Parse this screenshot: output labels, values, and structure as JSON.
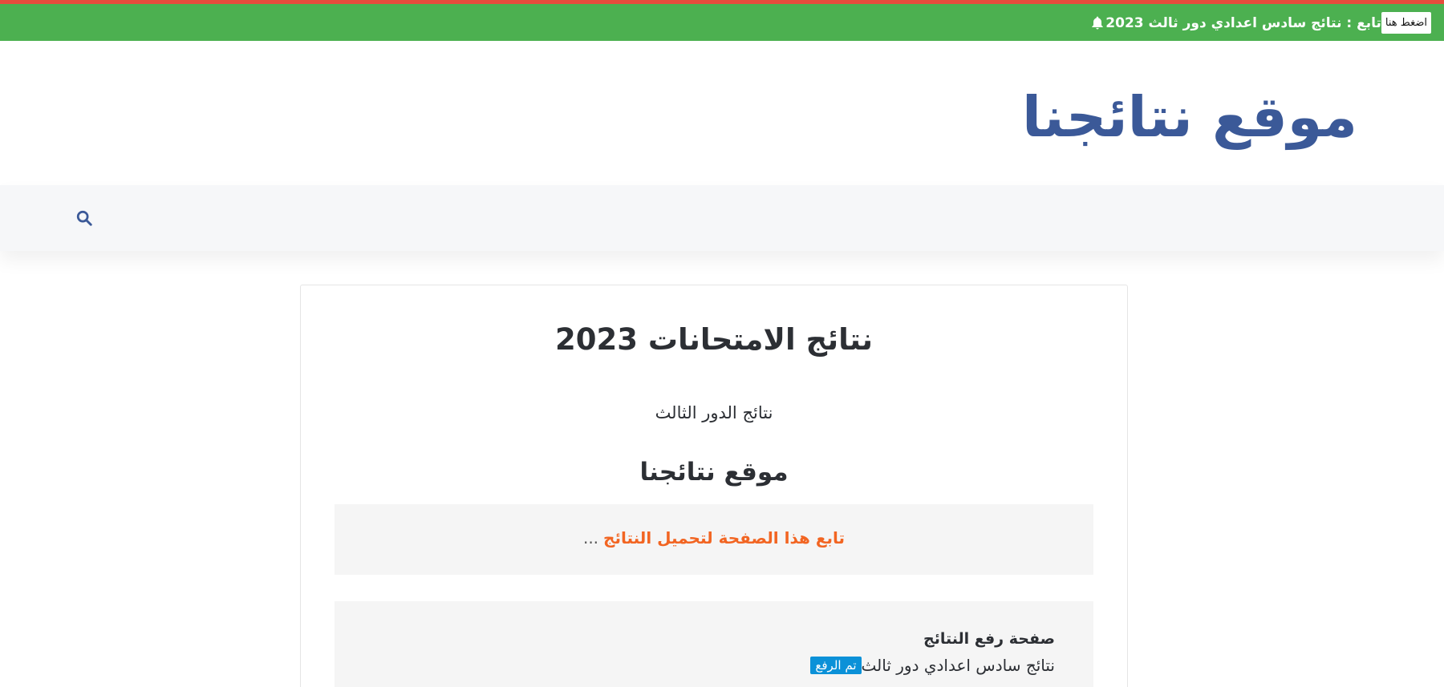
{
  "topbar": {
    "ticker_text": "تابع : نتائج سادس اعدادي دور ثالث 2023",
    "button_label": "اضغط هنا",
    "bar_color": "#4cb050",
    "accent_color": "#e74c3c",
    "icon": "bell-icon"
  },
  "header": {
    "site_title": "موقع نتائجنا",
    "title_color": "#3b5998"
  },
  "nav": {
    "icon": "search-icon"
  },
  "post": {
    "title": "نتائج الامتحانات 2023",
    "subtitle": "نتائج الدور الثالث",
    "site_name": "موقع نتائجنا",
    "notice_link": "تابع هذا الصفحة لتحميل النتائج",
    "notice_suffix": "...",
    "notice_color": "#f26522"
  },
  "upload": {
    "heading": "صفحة رفع النتائج",
    "badge": "تم الرفع",
    "badge_color": "#0b91d8",
    "item": "نتائج سادس اعدادي دور ثالث"
  }
}
